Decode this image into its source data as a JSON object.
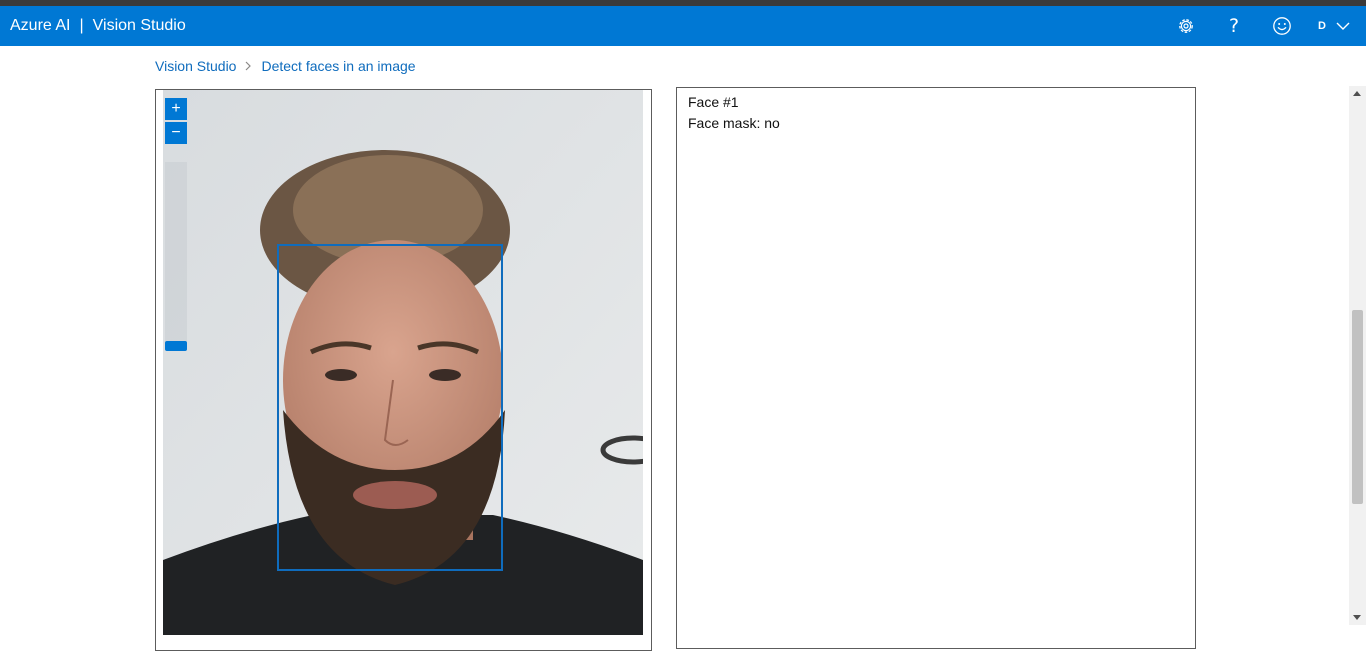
{
  "header": {
    "brand": "Azure AI",
    "separator": "|",
    "product": "Vision Studio",
    "user_initial": "D",
    "icons": [
      "settings-gear-icon",
      "help-question-icon",
      "feedback-smiley-icon",
      "chevron-down-icon"
    ]
  },
  "breadcrumb": {
    "root": "Vision Studio",
    "current": "Detect faces in an image"
  },
  "viewer": {
    "zoom_in_label": "+",
    "zoom_out_label": "−"
  },
  "results": {
    "face_title": "Face #1",
    "face_mask": "Face mask: no"
  },
  "colors": {
    "header_bg": "#0078d4",
    "accent": "#0f6cbd",
    "top_strip": "#3b3a39"
  }
}
